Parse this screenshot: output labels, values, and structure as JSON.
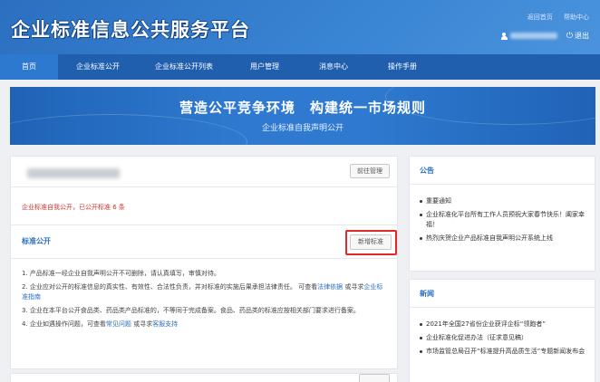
{
  "header": {
    "logo_text": "企业标准信息公共服务平台",
    "links": [
      "返回首页",
      "帮助中心"
    ],
    "logout_label": "退出"
  },
  "nav": {
    "items": [
      {
        "label": "首页",
        "active": true
      },
      {
        "label": "企业标准公开",
        "active": false
      },
      {
        "label": "企业标准公开列表",
        "active": false
      },
      {
        "label": "用户管理",
        "active": false
      },
      {
        "label": "消息中心",
        "active": false
      },
      {
        "label": "操作手册",
        "active": false
      }
    ]
  },
  "banner": {
    "title": "营造公平竞争环境　构建统一市场规则",
    "subtitle": "企业标准自我声明公开"
  },
  "company_panel": {
    "manage_button": "前往管理",
    "status_prefix": "企业标准自我公开，已公开标准 ",
    "status_count": "6",
    "status_suffix": " 条"
  },
  "standards_panel": {
    "title": "标准公开",
    "add_button": "新增标准",
    "items": [
      {
        "text": "1. 产品标准一经企业自我声明公开不可删除，请认真填写，审慎对待。"
      },
      {
        "text": "2. 企业应对公开的标准信息的真实性、有效性、合法性负责，并对标准的实施后果承担法律责任。 可查看",
        "link1": "法律依据",
        "mid": " 或寻求",
        "link2": "企业标准指南",
        "end": ""
      },
      {
        "text": "3. 企业在本平台公开食品类、药品类产品标准的，不等同于完成备案。食品、药品类的标准应按相关部门要求进行备案。"
      },
      {
        "text": "4. 企业如遇操作问题，可查看",
        "link1": "常见问题",
        "mid": " 或寻求",
        "link2": "客服支持",
        "end": ""
      }
    ]
  },
  "notice_panel": {
    "title": "公告",
    "items": [
      "重要通知",
      "企业标准化平台所有工作人员预祝大家春节快乐！阖家幸福！",
      "热烈庆贺企业产品标准自我声明公开系统上线"
    ]
  },
  "news_panel": {
    "title": "新闻",
    "items": [
      "2021年全国27省份企业获评企标“领跑者”",
      "企业标准化促进办法（征求意见稿）",
      "市场监管总局召开“标准提升高品质生活”专题新闻发布会"
    ]
  },
  "colors": {
    "header_blue": "#2b6fc0",
    "nav_blue": "#1f5fae",
    "accent_red": "#d9302c",
    "link_blue": "#2b6fc0"
  }
}
